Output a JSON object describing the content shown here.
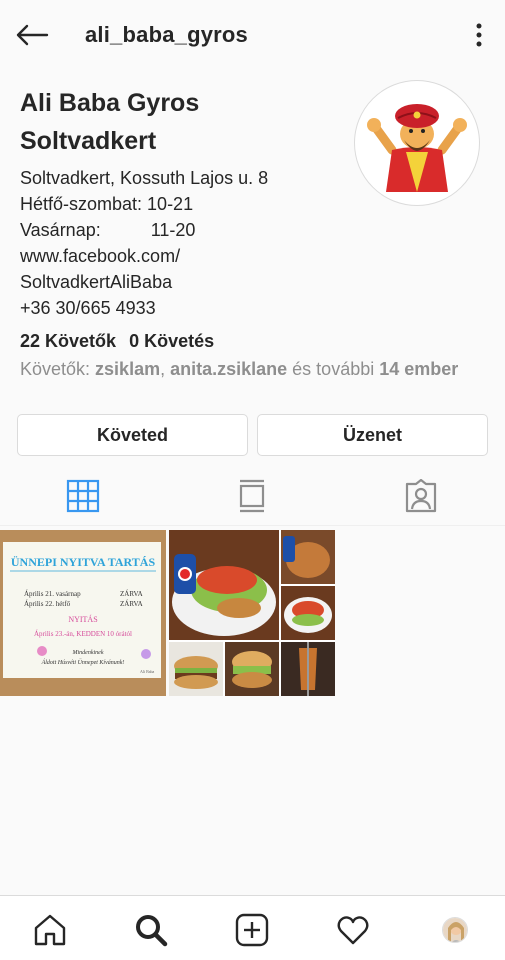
{
  "header": {
    "username": "ali_baba_gyros",
    "back_icon": "arrow-left-icon",
    "more_icon": "vertical-dots-icon"
  },
  "profile": {
    "name_line1": "Ali Baba Gyros",
    "name_line2": "Soltvadkert",
    "bio_lines": [
      "Soltvadkert, Kossuth Lajos u. 8",
      "Hétfő-szombat: 10-21",
      "Vasárnap:          11-20",
      "www.facebook.com/",
      "SoltvadkertAliBaba",
      "+36 30/665 4933"
    ],
    "followers_count": "22 Követők",
    "following_count": "0 Követés",
    "followed_by_prefix": "Követők: ",
    "followed_by_user1": "zsiklam",
    "followed_by_sep": ", ",
    "followed_by_user2": "anita.zsiklane",
    "followed_by_mid": " és további ",
    "followed_by_more": "14 ember"
  },
  "buttons": {
    "following": "Követed",
    "message": "Üzenet"
  },
  "tabs": [
    {
      "icon": "grid-icon",
      "active": true
    },
    {
      "icon": "feed-icon",
      "active": false
    },
    {
      "icon": "tagged-icon",
      "active": false
    }
  ],
  "posts": {
    "post1": {
      "title": "ÜNNEPI NYITVA TARTÁS",
      "row1_label": "Április 21. vasárnap",
      "row1_value": "ZÁRVA",
      "row2_label": "Április 22. hétfő",
      "row2_value": "ZÁRVA",
      "open_heading": "NYITÁS",
      "open_text": "Április 23.-án, KEDDEN 10 órától",
      "wish1": "Mindenkinek",
      "wish2": "Áldott Húsvéti Ünnepet Kívánunk!",
      "signature": "Ali Baba"
    }
  },
  "bottom_nav": [
    "home-icon",
    "search-icon",
    "new-post-icon",
    "heart-icon",
    "profile-avatar"
  ]
}
